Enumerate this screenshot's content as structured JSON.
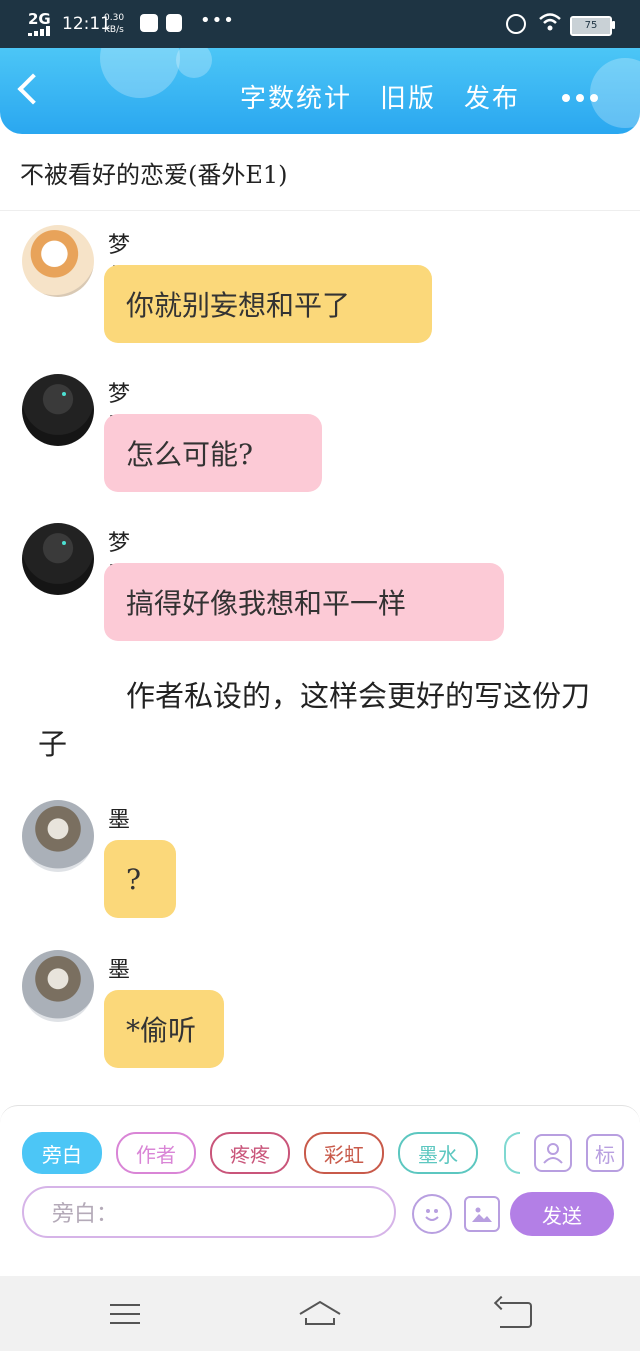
{
  "status_bar": {
    "network": "2G",
    "time": "12:11",
    "speed_value": "0.30",
    "speed_unit": "KB/s",
    "battery": "75"
  },
  "header": {
    "actions": [
      "字数统计",
      "旧版",
      "发布"
    ]
  },
  "story_title": "不被看好的恋爱(番外E1)",
  "messages": [
    {
      "name": "梦想",
      "text": "你就别妄想和平了",
      "bubble": "yellow"
    },
    {
      "name": "梦魇",
      "text": "怎么可能?",
      "bubble": "pink"
    },
    {
      "name": "梦魇",
      "text": "搞得好像我想和平一样",
      "bubble": "pink"
    },
    {
      "name": "墨水",
      "text": "?",
      "bubble": "yellow"
    },
    {
      "name": "墨水",
      "text": "*偷听",
      "bubble": "yellow"
    }
  ],
  "narration": "作者私设的，这样会更好的写这份刀子",
  "composer": {
    "roles": [
      {
        "label": "旁白",
        "color": "#4cc6f6"
      },
      {
        "label": "作者",
        "color": "#d985d6"
      },
      {
        "label": "疼疼",
        "color": "#c9557a"
      },
      {
        "label": "彩虹",
        "color": "#c85a4a"
      },
      {
        "label": "墨水",
        "color": "#5cc7c0"
      }
    ],
    "profile_icon": "person-card-icon",
    "tag_button": "标",
    "input_placeholder": "旁白：",
    "emoji_icon": "smiley-icon",
    "image_icon": "image-icon",
    "send_label": "发送"
  },
  "nav": {
    "icons": [
      "menu-icon",
      "home-icon",
      "back-icon"
    ]
  }
}
